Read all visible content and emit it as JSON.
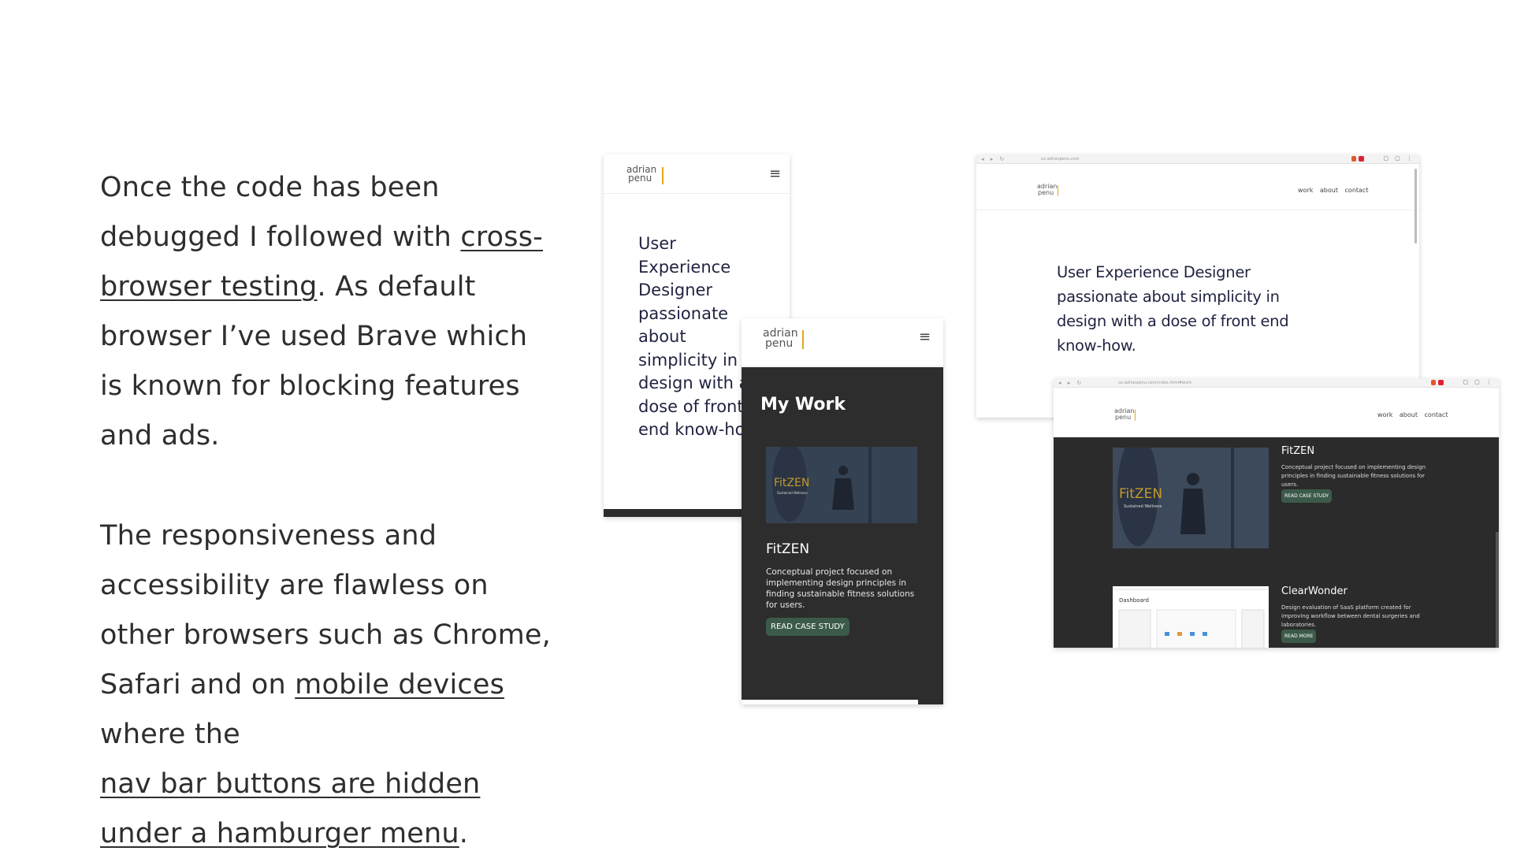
{
  "paragraph1": {
    "t1": "Once the code has been debugged I followed with ",
    "link1": "cross-browser testing",
    "t2": ". As default browser I’ve used Brave which is known for blocking features and ads."
  },
  "paragraph2": {
    "t1": "The responsiveness and accessibility are flawless on other browsers such as Chrome, Safari and on ",
    "link1": "mobile devices",
    "t2": " where the ",
    "link2": "nav bar buttons are hidden",
    "link3": "under a hamburger menu",
    "t3": "."
  },
  "site": {
    "logo_top": "adrian",
    "logo_bottom": "penu",
    "hamburger": "≡",
    "hero": "User Experience Designer passionate about simplicity in design with a dose of front end know-how.",
    "nav": "work about contact",
    "section_title": "My Work",
    "project1_title": "FitZEN",
    "project1_desc": "Conceptual project focused on implementing design principles in finding sustainable fitness solutions for users.",
    "project1_cta": "READ CASE STUDY",
    "project2_title": "ClearWonder",
    "project2_desc": "Design evaluation of SaaS platform created for improving workflow between dental surgeries and laboratories.",
    "project2_cta": "READ MORE",
    "thumb_brand": "FitZEN",
    "thumb_sub": "Sustained Wellness",
    "thumb2_title": "Dashboard"
  },
  "browser": {
    "nav_glyphs": "◂ ▸ ↻",
    "url1": "ux.adrianpenu.com",
    "url2": "ux.adrianpenu.com/index.html#work",
    "win_glyphs": "▢ ▢ ⋮"
  },
  "colors": {
    "link_underline": "#2e2e2e",
    "logo_accent": "#e6a817",
    "cta_green": "#3c5a4a",
    "dark_bg": "#2d2d2d"
  }
}
